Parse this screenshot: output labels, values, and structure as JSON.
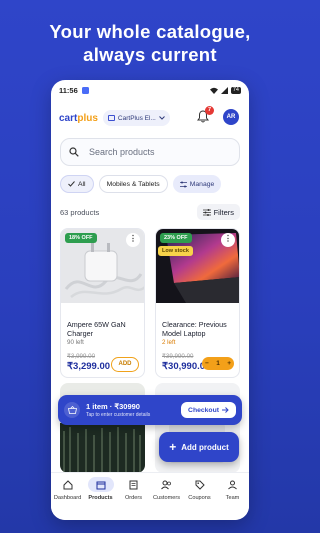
{
  "promo": {
    "line1": "Your whole catalogue,",
    "line2": "always current"
  },
  "status": {
    "time": "11:56",
    "battery": "74"
  },
  "appbar": {
    "logo_main": "cart",
    "logo_accent": "plus",
    "store": "CartPlus El...",
    "notifications": "7",
    "avatar": "AR"
  },
  "search": {
    "placeholder": "Search products"
  },
  "chips": [
    {
      "label": "All",
      "selected": true
    },
    {
      "label": "Mobiles & Tablets",
      "selected": false
    },
    {
      "label": "Manage",
      "selected": false
    }
  ],
  "list": {
    "count": "63 products",
    "filters": "Filters"
  },
  "products": [
    {
      "tag": "18% OFF",
      "name": "Ampere 65W GaN Charger",
      "stock": "90 left",
      "mrp": "₹3,999.00",
      "price": "₹3,299.00",
      "action": "ADD"
    },
    {
      "tag": "23% OFF",
      "badge": "Low stock",
      "name": "Clearance: Previous Model Laptop",
      "stock": "2 left",
      "mrp": "₹39,990.00",
      "price": "₹30,990.00",
      "qty": "1"
    }
  ],
  "checkout_bar": {
    "title": "1 item · ₹30990",
    "subtitle": "Tap to enter customer details",
    "button": "Checkout"
  },
  "fab": {
    "label": "Add product"
  },
  "nav": [
    {
      "label": "Dashboard",
      "icon": "home-icon"
    },
    {
      "label": "Products",
      "icon": "box-icon",
      "active": true
    },
    {
      "label": "Orders",
      "icon": "receipt-icon"
    },
    {
      "label": "Customers",
      "icon": "users-icon"
    },
    {
      "label": "Coupons",
      "icon": "tag-icon"
    },
    {
      "label": "Team",
      "icon": "team-icon"
    }
  ],
  "colors": {
    "brand": "#2f45c9",
    "accent": "#f3a019",
    "discount": "#2e9e4f"
  }
}
